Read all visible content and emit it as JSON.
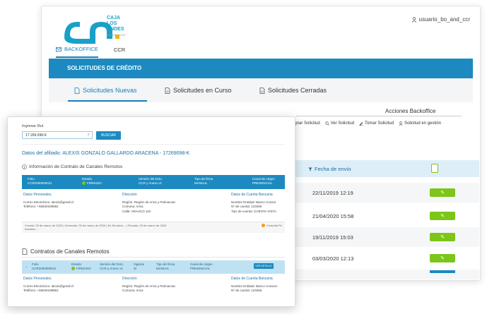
{
  "header": {
    "logo_line1": "CAJA",
    "logo_line2": "LOS",
    "logo_line3": "ANDES",
    "logo_small": "SOMOS CCAF",
    "user": "usuario_bo_and_ccr"
  },
  "nav": {
    "items": [
      {
        "label": "BACKOFFICE",
        "icon": "mail-icon"
      },
      {
        "label": "CCR"
      }
    ]
  },
  "banner": "SOLICITUDES DE CRÉDITO",
  "tabs": [
    "Solicitudes Nuevas",
    "Solicitudes en Curso",
    "Solicitudes Cerradas"
  ],
  "acciones": {
    "title": "Acciones Backoffice",
    "items": [
      "signar Solicitud",
      "Ver Solicitud",
      "Tomar Solicitud",
      "Solicitud en gestión"
    ]
  },
  "grid": {
    "col_fecha": "Fecha de envío",
    "rows": [
      "22/11/2019 12:19",
      "21/04/2020 15:58",
      "19/11/2019 15:03",
      "03/03/2020 12:13"
    ]
  },
  "front": {
    "search_label": "Ingresar Rut",
    "search_value": "17.269.098-K",
    "search_button": "BUSCAR",
    "afiliado_title": "Datos del afiliado: ALEXIS GONZALO GALLARDO ARACENA - 17269098-K",
    "contrato_title": "Información de Contrato de Canales Remotos",
    "table1": {
      "headers": [
        "Folio",
        "Estado",
        "Versión del Dcto.",
        "Tipo de firma",
        "Canal de origen"
      ],
      "values": [
        "CCR2000000011",
        "FIRMADO",
        "CCR y Anexo v1",
        "MANUAL",
        "PRESENCIAL"
      ]
    },
    "personal": {
      "title": "Datos Personales",
      "lines": [
        "Correo Electrónico: alexis@gmail.cl",
        "Teléfono: +56940199852"
      ]
    },
    "direccion": {
      "title": "Dirección",
      "lines": [
        "Región: Región de Arica y Parinacota",
        "Comuna: Arica",
        "Calle: ARAUCO 110"
      ]
    },
    "banco": {
      "title": "Datos de Cuenta Bancaria",
      "lines": [
        "Nombre Entidad: Banco Consor",
        "Nº de cuenta: 123456",
        "Tipo de cuenta: CUENTA VISTA"
      ]
    },
    "trace": {
      "line1": "Creado: 25 de marzo de 2020   |   Generado: 25 de marzo de 2020   |   En Revisión: -   |   Firmado: 25 de marzo de 2020",
      "line2": "Anulado: -",
      "custodia": "Custodia Pe"
    },
    "contratos_title": "Contratos de Canales Remotos",
    "table2": {
      "headers": [
        "Folio",
        "Estado",
        "Versión del Dcto.",
        "Vigente",
        "Tipo de firma",
        "Canal de origen"
      ],
      "values": [
        "CCR2000000011",
        "FIRMADO",
        "CCR y Anexo v1",
        "SI",
        "MANUAL",
        "PRESENCIAL"
      ],
      "button": "VER DETALLE"
    },
    "personal2": {
      "title": "Datos Personales",
      "lines": [
        "Correo Electrónico: alexis@gmail.cl",
        "Teléfono: +56940199852"
      ]
    },
    "direccion2": {
      "title": "Dirección",
      "lines": [
        "Región: Región de Arica y Parinacota",
        "Comuna: Arica"
      ]
    },
    "banco2": {
      "title": "Datos de Cuenta Bancaria",
      "lines": [
        "Nombre Entidad: Banco Consorc",
        "Nº de cuenta: 123456"
      ]
    }
  },
  "colors": {
    "primary": "#1c8ac0",
    "accent": "#7cc618",
    "warning": "#f29a1f"
  }
}
